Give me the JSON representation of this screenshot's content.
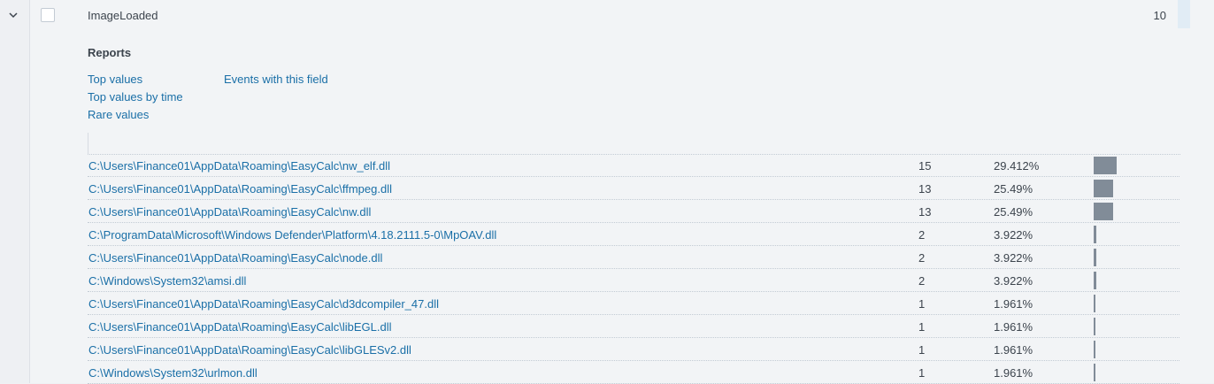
{
  "field": {
    "name": "ImageLoaded",
    "count": "10"
  },
  "reports": {
    "title": "Reports",
    "top_values": "Top values",
    "top_values_by_time": "Top values by time",
    "rare_values": "Rare values",
    "events_with_field": "Events with this field"
  },
  "rows": [
    {
      "value": "C:\\Users\\Finance01\\AppData\\Roaming\\EasyCalc\\nw_elf.dll",
      "count": "15",
      "percent": "29.412%",
      "pct": 29.412
    },
    {
      "value": "C:\\Users\\Finance01\\AppData\\Roaming\\EasyCalc\\ffmpeg.dll",
      "count": "13",
      "percent": "25.49%",
      "pct": 25.49
    },
    {
      "value": "C:\\Users\\Finance01\\AppData\\Roaming\\EasyCalc\\nw.dll",
      "count": "13",
      "percent": "25.49%",
      "pct": 25.49
    },
    {
      "value": "C:\\ProgramData\\Microsoft\\Windows Defender\\Platform\\4.18.2111.5-0\\MpOAV.dll",
      "count": "2",
      "percent": "3.922%",
      "pct": 3.922
    },
    {
      "value": "C:\\Users\\Finance01\\AppData\\Roaming\\EasyCalc\\node.dll",
      "count": "2",
      "percent": "3.922%",
      "pct": 3.922
    },
    {
      "value": "C:\\Windows\\System32\\amsi.dll",
      "count": "2",
      "percent": "3.922%",
      "pct": 3.922
    },
    {
      "value": "C:\\Users\\Finance01\\AppData\\Roaming\\EasyCalc\\d3dcompiler_47.dll",
      "count": "1",
      "percent": "1.961%",
      "pct": 1.961
    },
    {
      "value": "C:\\Users\\Finance01\\AppData\\Roaming\\EasyCalc\\libEGL.dll",
      "count": "1",
      "percent": "1.961%",
      "pct": 1.961
    },
    {
      "value": "C:\\Users\\Finance01\\AppData\\Roaming\\EasyCalc\\libGLESv2.dll",
      "count": "1",
      "percent": "1.961%",
      "pct": 1.961
    },
    {
      "value": "C:\\Windows\\System32\\urlmon.dll",
      "count": "1",
      "percent": "1.961%",
      "pct": 1.961
    }
  ]
}
